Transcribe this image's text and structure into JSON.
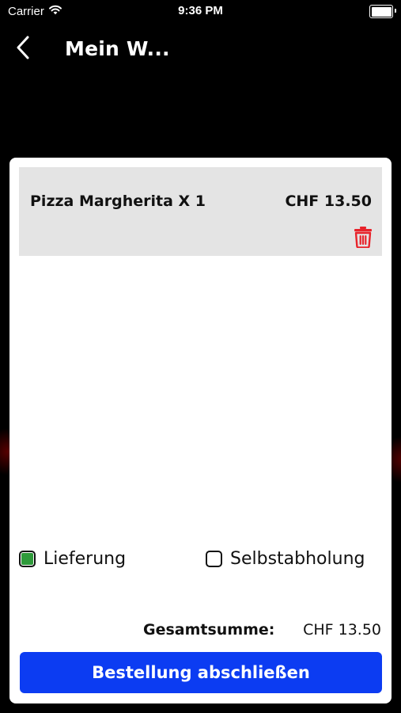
{
  "status_bar": {
    "carrier": "Carrier",
    "time": "9:36 PM",
    "wifi_icon": "wifi-icon",
    "battery_icon": "battery-icon"
  },
  "nav": {
    "back_icon": "chevron-left-icon",
    "title": "Mein W..."
  },
  "cart": {
    "items": [
      {
        "name": "Pizza Margherita X 1",
        "price": "CHF 13.50",
        "delete_icon": "trash-icon"
      }
    ]
  },
  "options": {
    "delivery_label": "Lieferung",
    "delivery_checked": true,
    "pickup_label": "Selbstabholung",
    "pickup_checked": false
  },
  "summary": {
    "total_label": "Gesamtsumme:",
    "total_value": "CHF 13.50"
  },
  "checkout": {
    "button_label": "Bestellung abschließen"
  },
  "colors": {
    "background": "#000000",
    "card": "#ffffff",
    "item_background": "#e4e4e4",
    "accent_button": "#0c3cf2",
    "delete_red": "#e8232b",
    "checkbox_green": "#2e9a3a"
  }
}
